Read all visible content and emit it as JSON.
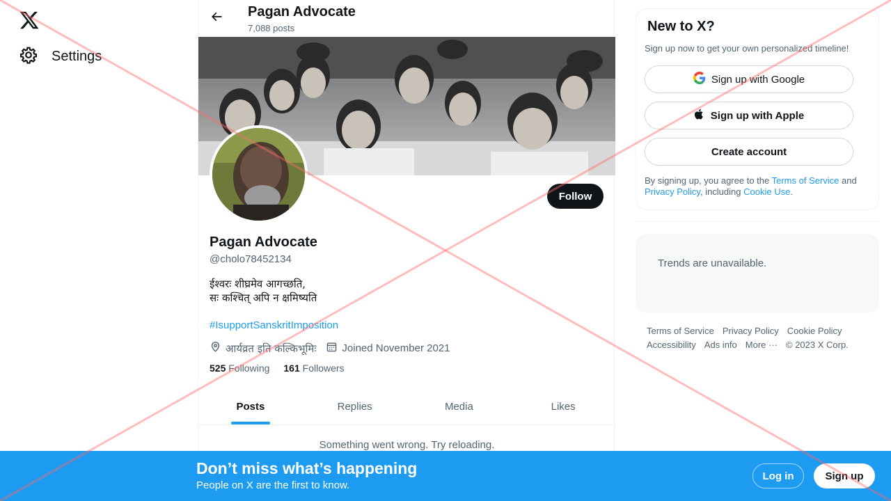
{
  "nav": {
    "settings_label": "Settings"
  },
  "header": {
    "name": "Pagan Advocate",
    "post_count": "7,088 posts"
  },
  "profile": {
    "name": "Pagan Advocate",
    "handle": "@cholo78452134",
    "bio_line1": "ईश्वरः शीघ्रमेव आगच्छति,",
    "bio_line2": "सः कश्चित् अपि न क्षमिष्यति",
    "hashtag": "#IsupportSanskritImposition",
    "location": "आर्यव्रत इति कल्किभूमिः",
    "joined": "Joined November 2021",
    "following_count": "525",
    "following_label": "Following",
    "followers_count": "161",
    "followers_label": "Followers",
    "follow_label": "Follow"
  },
  "tabs": [
    {
      "label": "Posts"
    },
    {
      "label": "Replies"
    },
    {
      "label": "Media"
    },
    {
      "label": "Likes"
    }
  ],
  "error_message": "Something went wrong. Try reloading.",
  "signup_card": {
    "title": "New to X?",
    "subtitle": "Sign up now to get your own personalized timeline!",
    "google_label": "Sign up with Google",
    "apple_label": "Sign up with Apple",
    "create_label": "Create account",
    "terms_prefix": "By signing up, you agree to the ",
    "terms_link": "Terms of Service",
    "terms_and": " and ",
    "privacy_link": "Privacy Policy",
    "terms_including": ", including ",
    "cookie_link": "Cookie Use",
    "terms_end": "."
  },
  "trends": {
    "message": "Trends are unavailable."
  },
  "footer": {
    "terms": "Terms of Service",
    "privacy": "Privacy Policy",
    "cookie": "Cookie Policy",
    "accessibility": "Accessibility",
    "ads": "Ads info",
    "more": "More ···",
    "copyright": "© 2023 X Corp."
  },
  "bottom_bar": {
    "title": "Don’t miss what’s happening",
    "subtitle": "People on X are the first to know.",
    "login_label": "Log in",
    "signup_label": "Sign up"
  },
  "colors": {
    "accent": "#1d9bf0",
    "text": "#0f1419",
    "muted": "#536471",
    "overlay_cross": "#ff6b6b"
  }
}
